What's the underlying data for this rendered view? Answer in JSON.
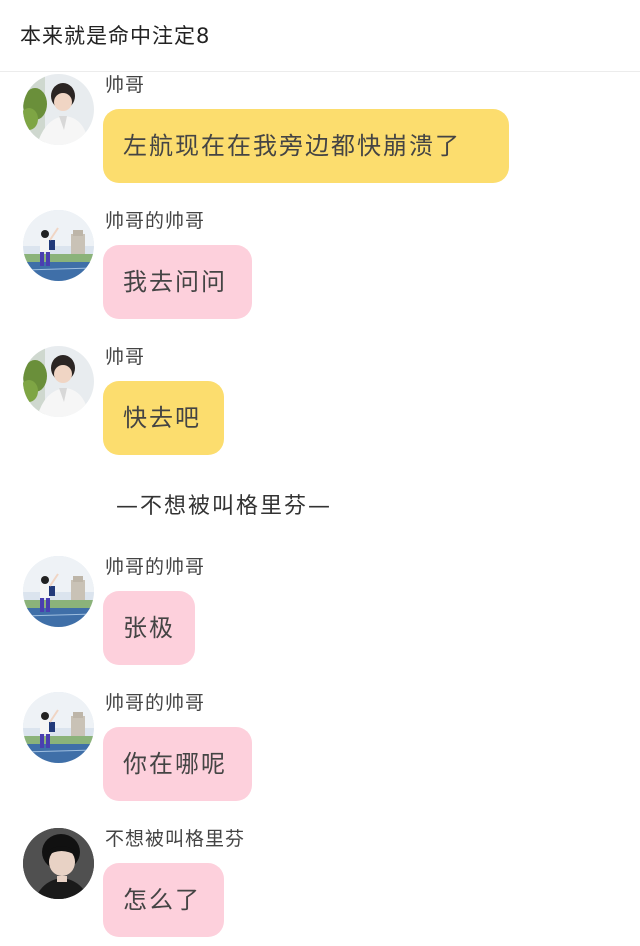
{
  "header": {
    "title": "本来就是命中注定8"
  },
  "messages": [
    {
      "sender": "帅哥",
      "text": "左航现在在我旁边都快崩溃了",
      "bubble_color": "#fcdd6e",
      "avatar": "boy-with-plant-avatar"
    },
    {
      "sender": "帅哥的帅哥",
      "text": "我去问问",
      "bubble_color": "#fdd0dc",
      "avatar": "track-field-avatar"
    },
    {
      "sender": "帅哥",
      "text": "快去吧",
      "bubble_color": "#fcdd6e",
      "avatar": "boy-with-plant-avatar"
    },
    {
      "sender": "帅哥的帅哥",
      "text": "张极",
      "bubble_color": "#fdd0dc",
      "avatar": "track-field-avatar"
    },
    {
      "sender": "帅哥的帅哥",
      "text": "你在哪呢",
      "bubble_color": "#fdd0dc",
      "avatar": "track-field-avatar"
    },
    {
      "sender": "不想被叫格里芬",
      "text": "怎么了",
      "bubble_color": "#fdd0dc",
      "avatar": "dark-portrait-avatar"
    }
  ],
  "divider": {
    "text": "—不想被叫格里芬—"
  }
}
